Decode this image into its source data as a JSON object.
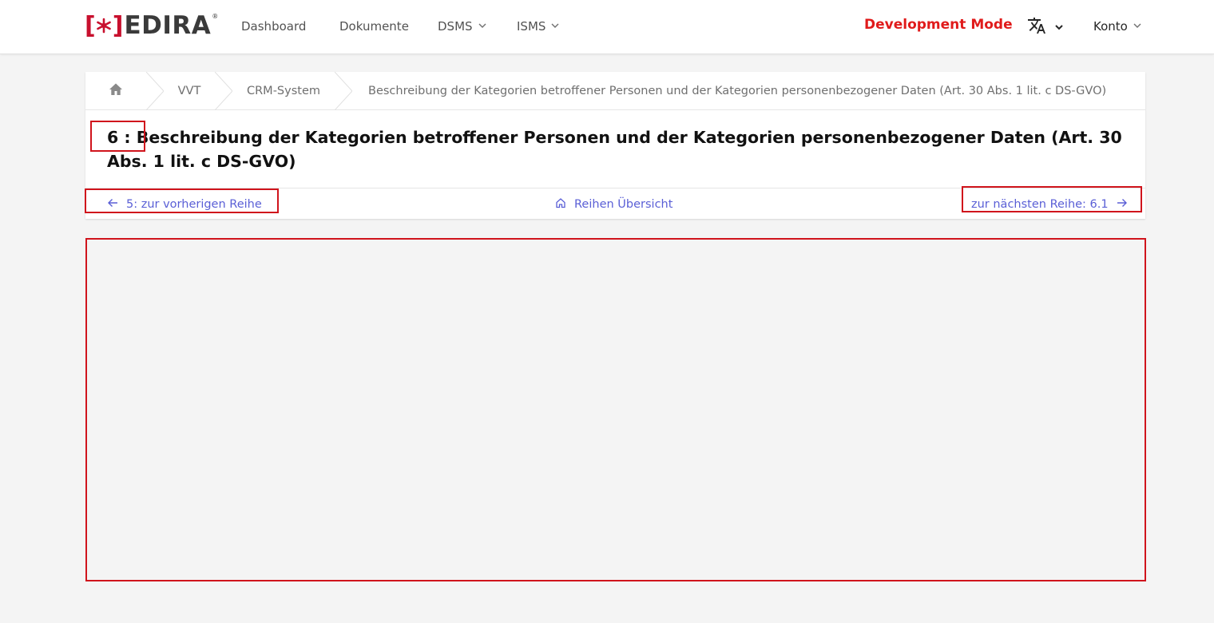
{
  "app": {
    "logo_text": "EDIRA",
    "logo_registered": "®",
    "brand_color": "#c8102e"
  },
  "nav": {
    "items": [
      {
        "label": "Dashboard"
      },
      {
        "label": "Dokumente"
      },
      {
        "label": "DSMS"
      },
      {
        "label": "ISMS"
      }
    ],
    "dev_mode": "Development Mode",
    "language_icon": "translate-icon",
    "account": "Konto"
  },
  "breadcrumb": {
    "home_icon": "home-icon",
    "items": [
      {
        "label": "VVT"
      },
      {
        "label": "CRM-System"
      },
      {
        "label": "Beschreibung der Kategorien betroffener Personen und der Kategorien personenbezogener Daten (Art. 30 Abs. 1 lit. c DS-GVO)"
      }
    ]
  },
  "page": {
    "title": "6 : Beschreibung der Kategorien betroffener Personen und der Kategorien personenbezogener Daten (Art. 30 Abs. 1 lit. c DS-GVO)"
  },
  "row_nav": {
    "prev": "5: zur vorherigen Reihe",
    "overview": "Reihen Übersicht",
    "next": "zur nächsten Reihe: 6.1"
  },
  "colors": {
    "link": "#5a5fd6",
    "dev_mode": "#e01b1b",
    "annotation": "#d0141c"
  }
}
